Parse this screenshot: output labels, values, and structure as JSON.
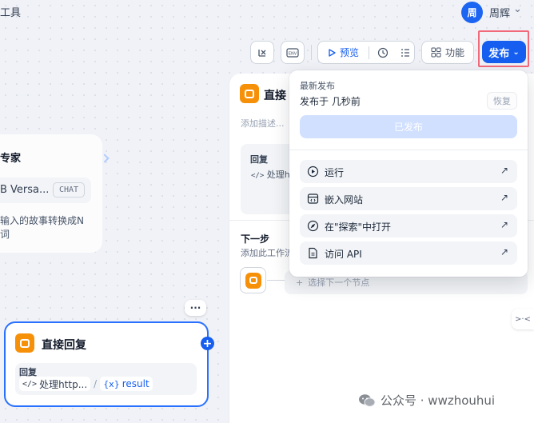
{
  "header": {
    "breadcrumb": "工具",
    "avatar_initial": "周",
    "username": "周辉"
  },
  "toolbar": {
    "preview_label": "预览",
    "features_label": "功能",
    "publish_label": "发布"
  },
  "canvas": {
    "llm_node": {
      "title": "专家",
      "model_name": "B Versa...",
      "model_badge": "CHAT",
      "description_line1": "输入的故事转换成N",
      "description_line2": "词"
    },
    "reply_node": {
      "title": "直接回复",
      "content_label": "回复",
      "var_text": "处理http...",
      "var_sep": "/",
      "var_name": "result"
    }
  },
  "panel": {
    "title": "直接",
    "desc_placeholder": "添加描述...",
    "reply_label": "回复",
    "reply_value": "处理ht",
    "next_title": "下一步",
    "next_desc": "添加此工作流",
    "next_select_placeholder": "选择下一个节点"
  },
  "publish_dropdown": {
    "heading": "最新发布",
    "published_time": "发布于 几秒前",
    "restore_label": "恢复",
    "published_button_label": "已发布",
    "items": [
      {
        "label": "运行",
        "icon": "play-circle-icon"
      },
      {
        "label": "嵌入网站",
        "icon": "embed-window-icon"
      },
      {
        "label": "在\"探索\"中打开",
        "icon": "explore-compass-icon"
      },
      {
        "label": "访问 API",
        "icon": "document-icon"
      }
    ]
  },
  "watermark": {
    "text": "公众号 · wwzhouhui"
  },
  "colors": {
    "primary": "#155eef",
    "highlight_border": "#f2697a",
    "node_orange": "#f79009",
    "published_disabled": "#d1e0ff"
  }
}
